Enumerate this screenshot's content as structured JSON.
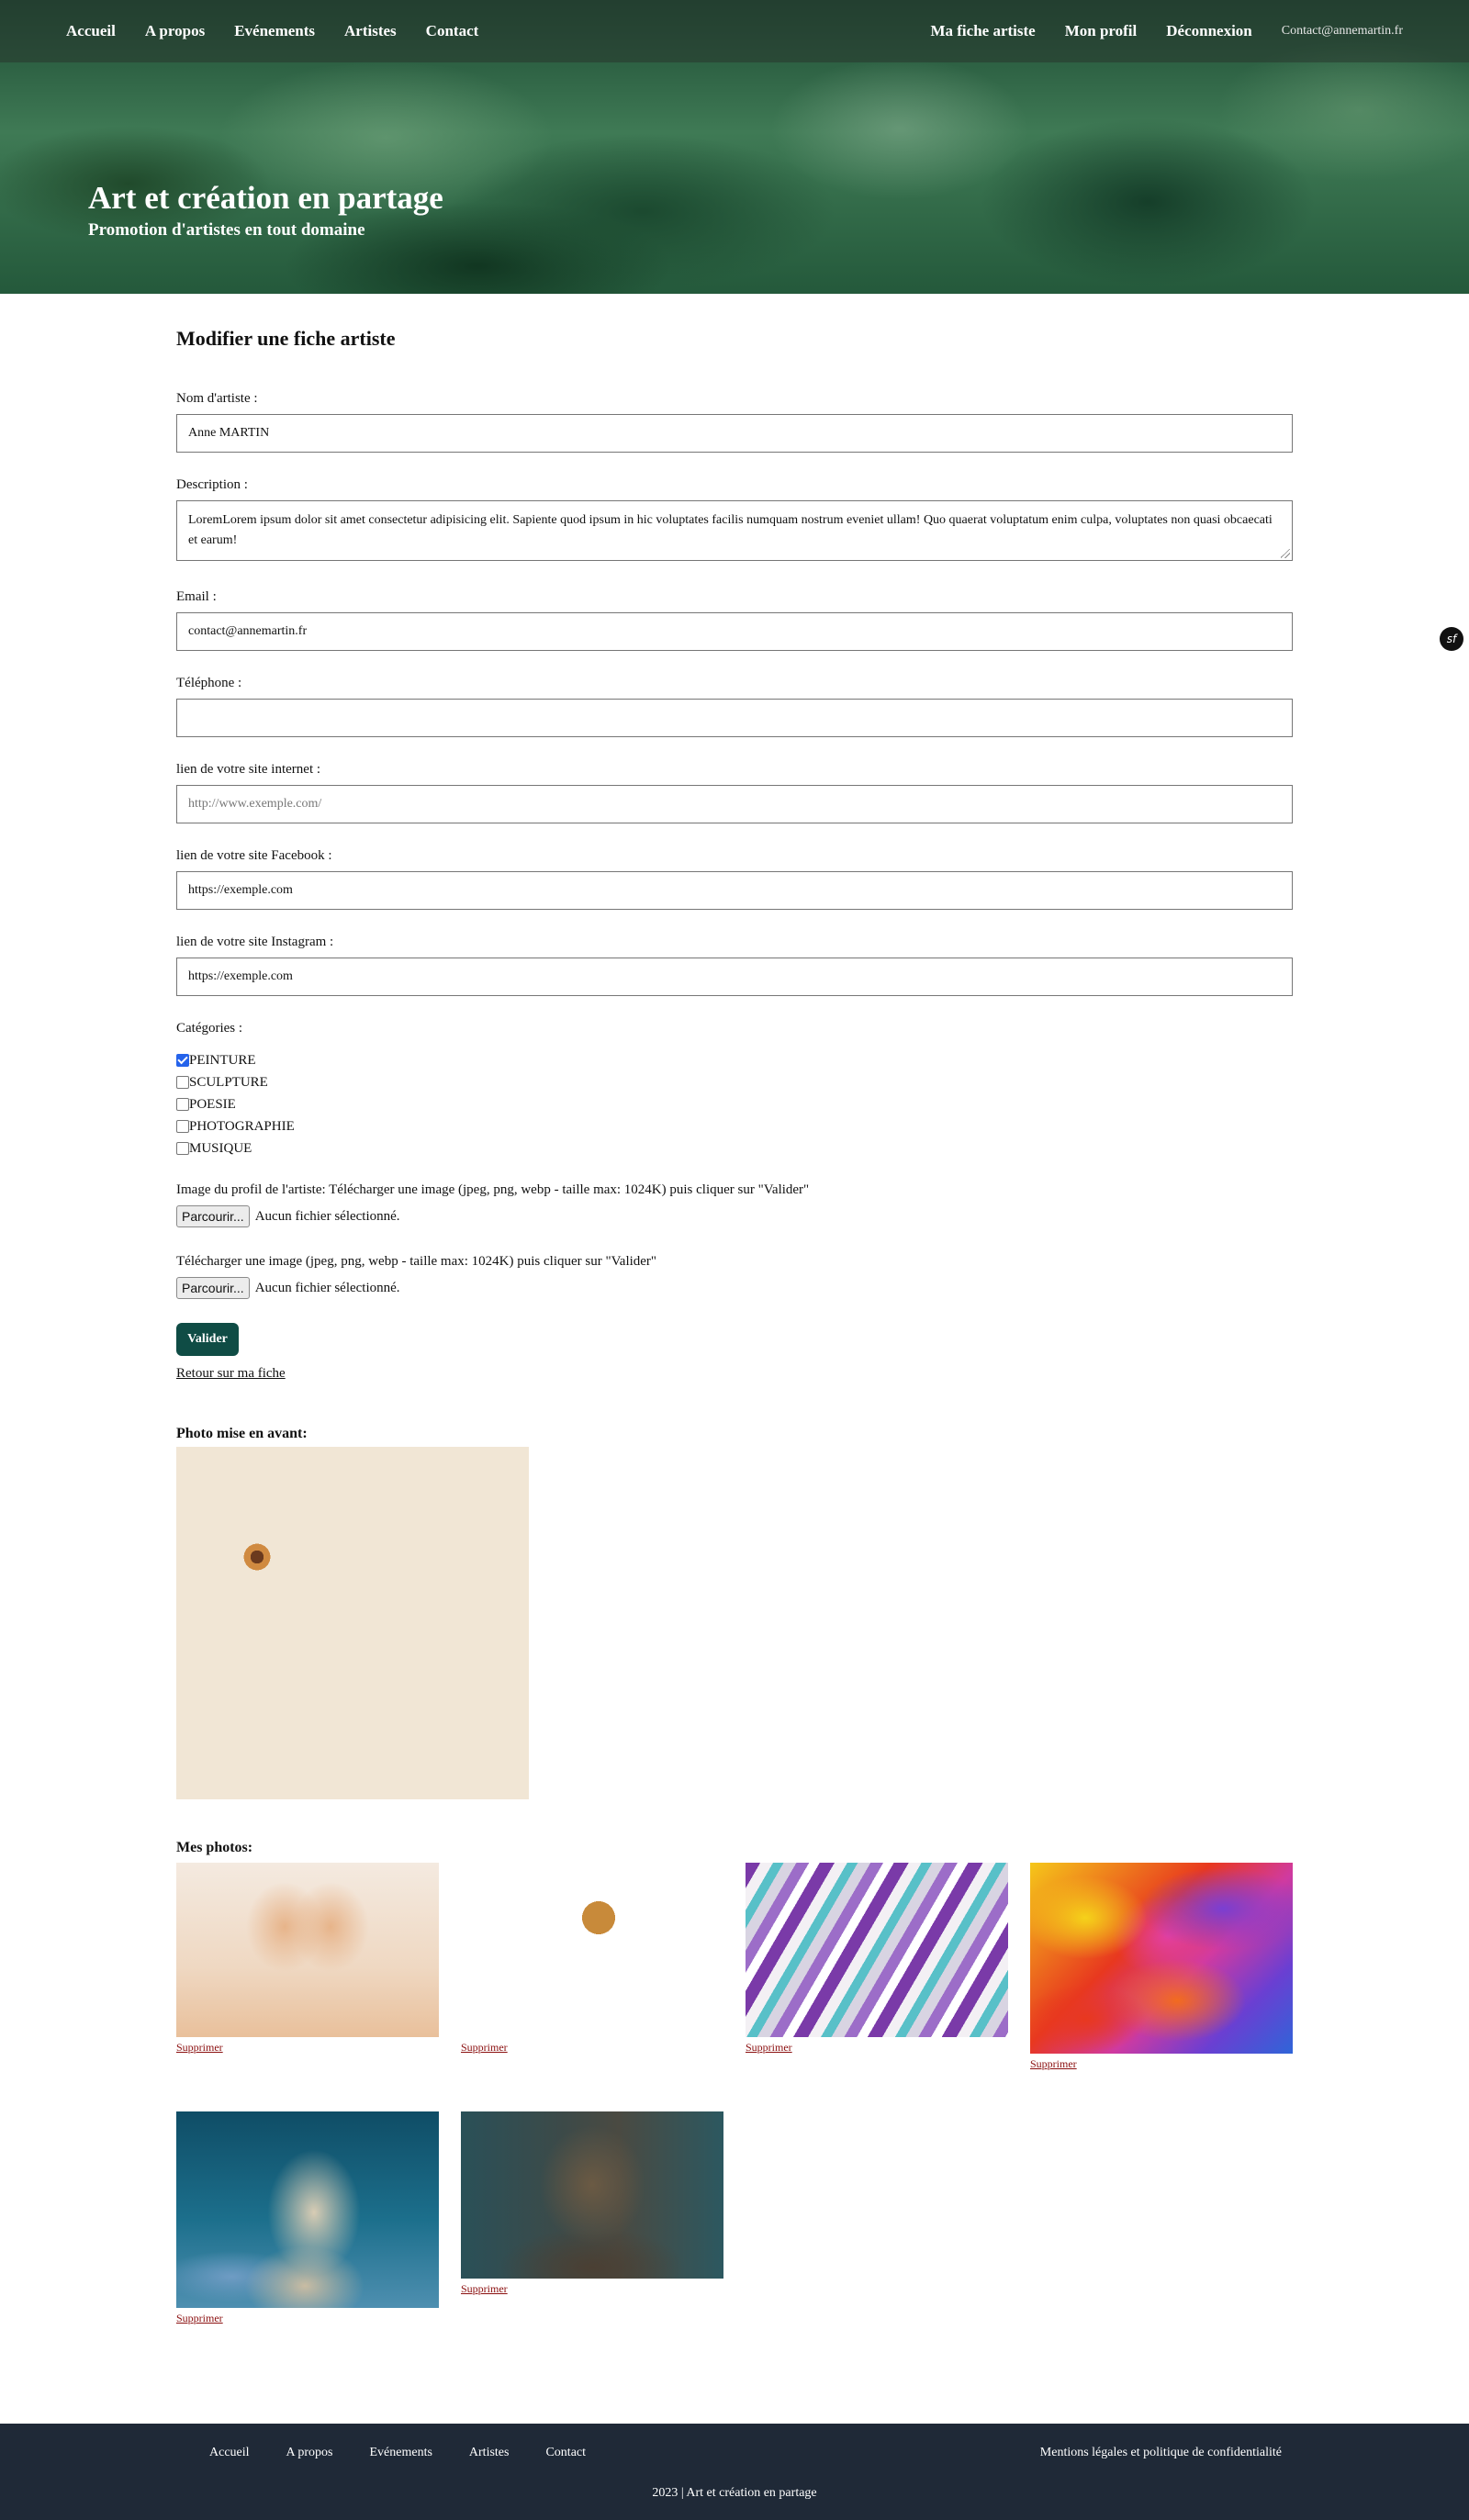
{
  "nav": {
    "left": [
      "Accueil",
      "A propos",
      "Evénements",
      "Artistes",
      "Contact"
    ],
    "right": [
      "Ma fiche artiste",
      "Mon profil",
      "Déconnexion"
    ],
    "contact_email": "Contact@annemartin.fr"
  },
  "hero": {
    "title": "Art et création en partage",
    "subtitle": "Promotion d'artistes en tout domaine"
  },
  "form": {
    "title": "Modifier une fiche artiste",
    "name_label": "Nom d'artiste :",
    "name_value": "Anne MARTIN",
    "description_label": "Description :",
    "description_value": "LoremLorem ipsum dolor sit amet consectetur adipisicing elit. Sapiente quod ipsum in hic voluptates facilis numquam nostrum eveniet ullam! Quo quaerat voluptatum enim culpa, voluptates non quasi obcaecati et earum!",
    "email_label": "Email :",
    "email_value": "contact@annemartin.fr",
    "phone_label": "Téléphone :",
    "phone_value": "",
    "website_label": "lien de votre site internet :",
    "website_placeholder": "http://www.exemple.com/",
    "facebook_label": "lien de votre site Facebook :",
    "facebook_value": "https://exemple.com",
    "instagram_label": "lien de votre site Instagram :",
    "instagram_value": "https://exemple.com",
    "categories_label": "Catégories :",
    "categories": [
      {
        "label": "PEINTURE",
        "checked": true
      },
      {
        "label": "SCULPTURE",
        "checked": false
      },
      {
        "label": "POESIE",
        "checked": false
      },
      {
        "label": "PHOTOGRAPHIE",
        "checked": false
      },
      {
        "label": "MUSIQUE",
        "checked": false
      }
    ],
    "profile_image_label": "Image du profil de l'artiste: Télécharger une image (jpeg, png, webp - taille max: 1024K) puis cliquer sur \"Valider\"",
    "upload_label": "Télécharger une image (jpeg, png, webp - taille max: 1024K) puis cliquer sur \"Valider\"",
    "browse_button": "Parcourir...",
    "no_file_text": "Aucun fichier sélectionné.",
    "submit_button": "Valider",
    "back_link": "Retour sur ma fiche"
  },
  "featured": {
    "heading": "Photo mise en avant:"
  },
  "gallery": {
    "heading": "Mes photos:",
    "delete_label": "Supprimer",
    "items": [
      "open-book-heart",
      "coffee-flowers-notebook",
      "marbled-paint",
      "colorful-paint-strokes",
      "statue-bust",
      "buddha-statue"
    ]
  },
  "dev_toolbar_icon": "sf",
  "footer": {
    "links": [
      "Accueil",
      "A propos",
      "Evénements",
      "Artistes",
      "Contact"
    ],
    "legal": "Mentions légales et politique de confidentialité",
    "copyright": "2023 | Art et création en partage"
  }
}
